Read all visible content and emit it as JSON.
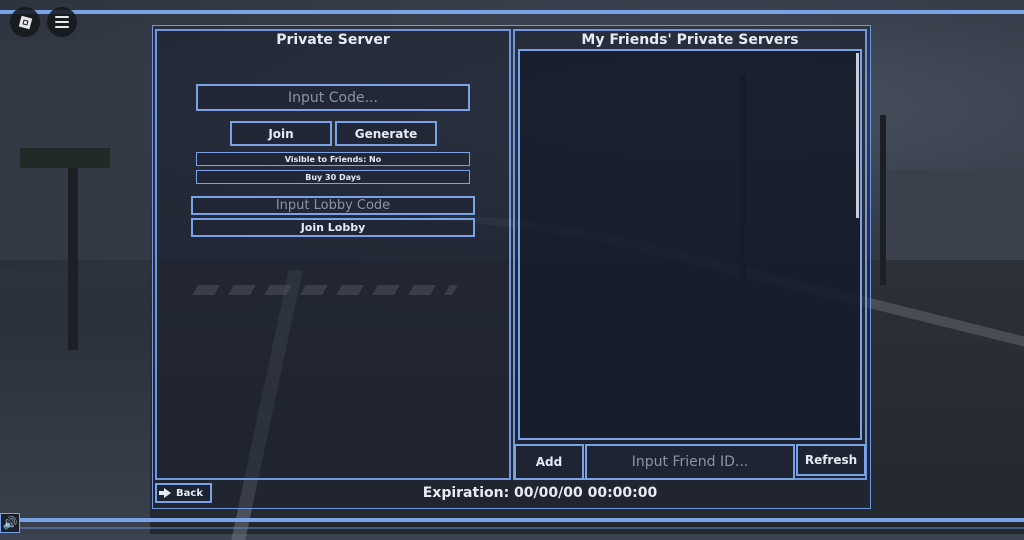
{
  "topbar": {
    "roblox_icon": "roblox-logo-icon",
    "menu_icon": "hamburger-menu-icon"
  },
  "private_server": {
    "title": "Private Server",
    "code_placeholder": "Input Code...",
    "join_label": "Join",
    "generate_label": "Generate",
    "visible_label": "Visible to Friends: No",
    "buy_label": "Buy 30 Days",
    "lobby_placeholder": "Input Lobby Code",
    "join_lobby_label": "Join Lobby"
  },
  "friends": {
    "title": "My Friends' Private Servers",
    "add_label": "Add",
    "friend_id_placeholder": "Input Friend ID...",
    "refresh_label": "Refresh"
  },
  "footer": {
    "back_label": "Back",
    "back_icon": "back-arrow-icon",
    "expiration": "Expiration: 00/00/00 00:00:00",
    "volume_icon": "speaker-icon"
  },
  "colors": {
    "accent": "#7aa2e6",
    "text": "#e6ebf6"
  }
}
